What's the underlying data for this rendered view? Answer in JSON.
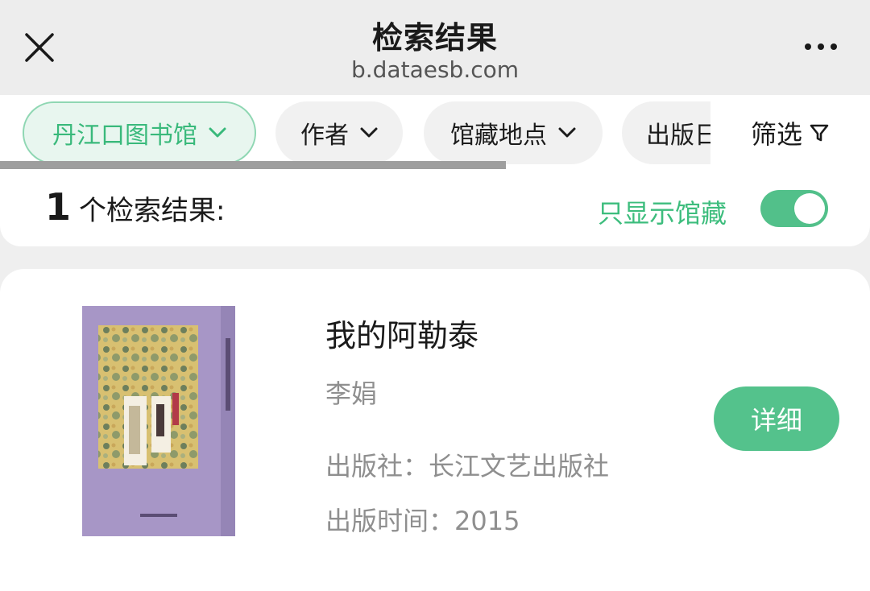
{
  "header": {
    "title": "检索结果",
    "subtitle": "b.dataesb.com",
    "close_icon": "close-icon",
    "more_icon": "more-horizontal-icon"
  },
  "filters": {
    "chips": [
      {
        "label": "丹江口图书馆",
        "active": true
      },
      {
        "label": "作者",
        "active": false
      },
      {
        "label": "馆藏地点",
        "active": false
      },
      {
        "label": "出版日",
        "active": false
      }
    ],
    "filter_label": "筛选",
    "filter_icon": "funnel-icon"
  },
  "results": {
    "count": "1",
    "count_label": "个检索结果:",
    "only_holdings_label": "只显示馆藏",
    "only_holdings_enabled": true
  },
  "book": {
    "title": "我的阿勒泰",
    "author": "李娟",
    "publisher": "出版社：长江文艺出版社",
    "publish_date": "出版时间：2015",
    "detail_button": "详细"
  },
  "colors": {
    "accent": "#52c08a",
    "accent_text": "#3dbd7d",
    "chip_active_bg": "#e8f6ef",
    "cover_bg": "#a796c6"
  }
}
